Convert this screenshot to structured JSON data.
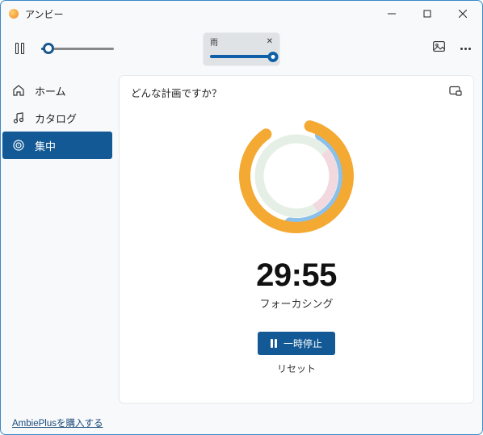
{
  "window": {
    "title": "アンビー"
  },
  "toolbar": {
    "volume_percent": 10,
    "sound_popup": {
      "label": "雨",
      "level_percent": 100
    }
  },
  "sidebar": {
    "items": [
      {
        "label": "ホーム"
      },
      {
        "label": "カタログ"
      },
      {
        "label": "集中"
      }
    ],
    "active_index": 2
  },
  "focus": {
    "prompt": "どんな計画ですか？",
    "timer": "29:55",
    "phase": "フォーカシング",
    "pause_label": "一時停止",
    "reset_label": "リセット"
  },
  "footer": {
    "purchase_link": "AmbiePlusを購入する"
  }
}
